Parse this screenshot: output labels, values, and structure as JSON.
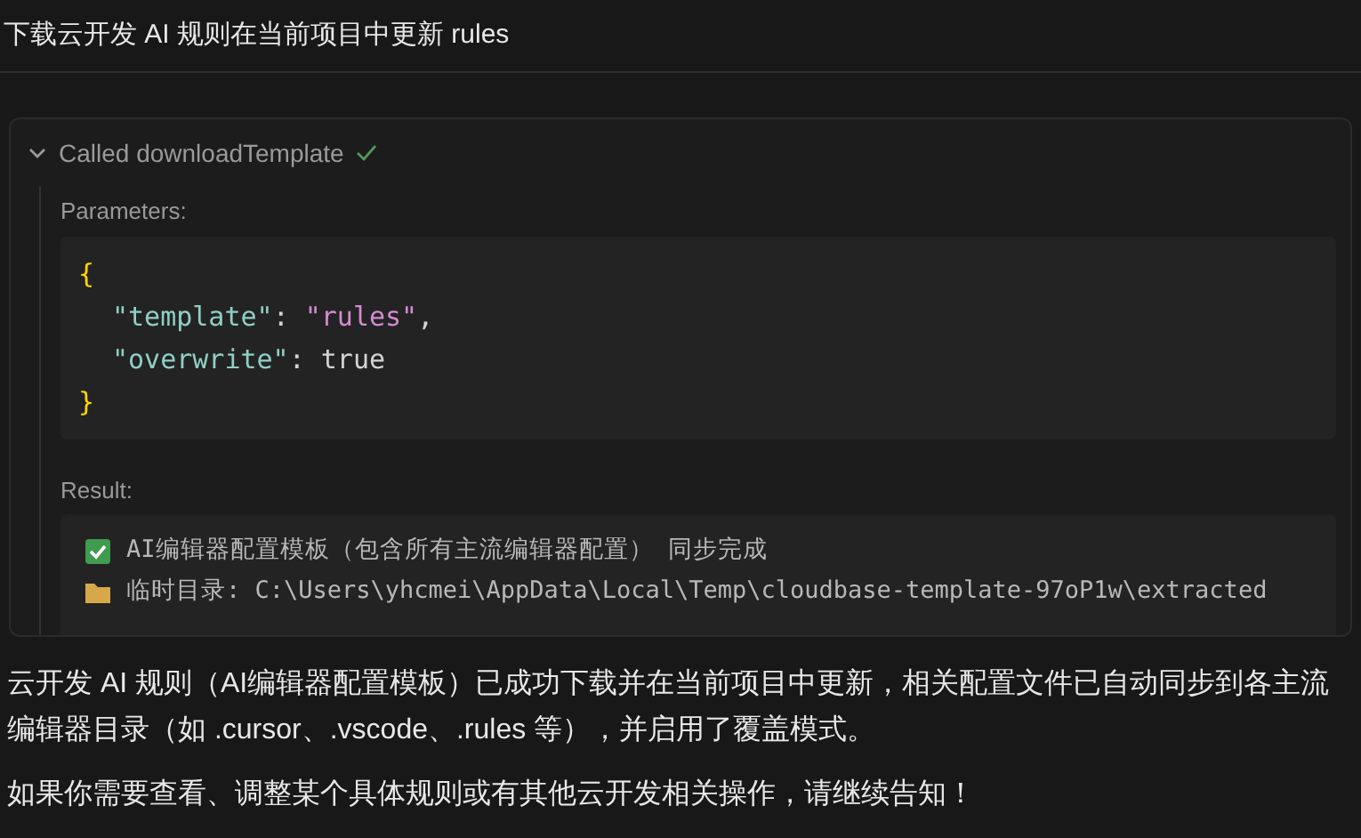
{
  "title": "下载云开发 AI 规则在当前项目中更新 rules",
  "tool_call": {
    "expanded": true,
    "label": "Called downloadTemplate",
    "completed": true,
    "parameters_label": "Parameters:",
    "parameters": {
      "open": "{",
      "close": "}",
      "entries": [
        {
          "key": "\"template\"",
          "sep": ":",
          "value": {
            "kind": "string",
            "text": "\"rules\""
          },
          "comma": ","
        },
        {
          "key": "\"overwrite\"",
          "sep": ":",
          "value": {
            "kind": "literal",
            "text": "true"
          }
        }
      ]
    },
    "result_label": "Result:",
    "result_lines": [
      {
        "kind": "check",
        "text": "AI编辑器配置模板（包含所有主流编辑器配置） 同步完成"
      },
      {
        "kind": "folder",
        "text": "临时目录: C:\\Users\\yhcmei\\AppData\\Local\\Temp\\cloudbase-template-97oP1w\\extracted"
      }
    ]
  },
  "paragraphs": [
    "云开发 AI 规则（AI编辑器配置模板）已成功下载并在当前项目中更新，相关配置文件已自动同步到各主流编辑器目录（如 .cursor、.vscode、.rules 等），并启用了覆盖模式。",
    "如果你需要查看、调整某个具体规则或有其他云开发相关操作，请继续告知！"
  ]
}
